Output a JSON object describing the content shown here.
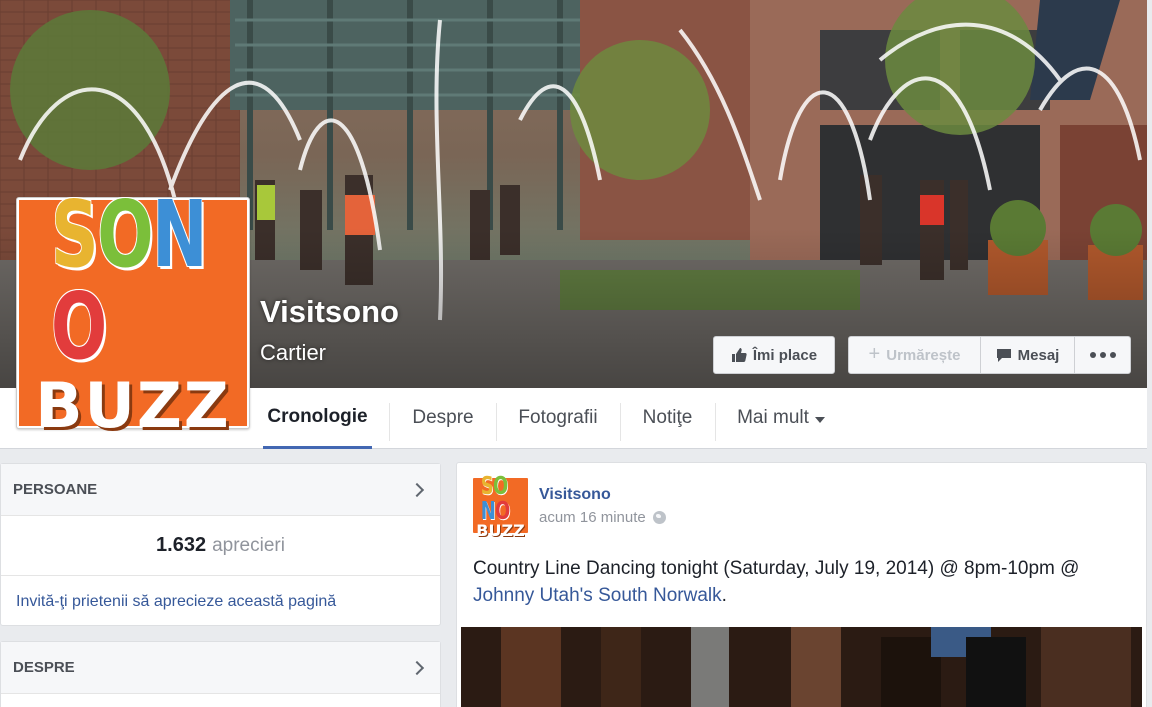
{
  "page": {
    "name": "Visitsono",
    "category": "Cartier"
  },
  "logo": {
    "letters": [
      "S",
      "O",
      "N",
      "O"
    ],
    "colors": [
      "#e8b430",
      "#7bbf3a",
      "#3d8fd6",
      "#e23c3c"
    ],
    "buzz": "BUZZ",
    "background": "#f26a25"
  },
  "actions": {
    "like_label": "Îmi place",
    "follow_label": "Urmărește",
    "message_label": "Mesaj",
    "like_icon": "thumbs-up-icon",
    "follow_icon": "plus-icon",
    "message_icon": "speech-bubble-icon",
    "more_icon": "more-dots-icon"
  },
  "tabs": [
    {
      "label": "Cronologie",
      "active": true
    },
    {
      "label": "Despre"
    },
    {
      "label": "Fotografii"
    },
    {
      "label": "Notiţe"
    },
    {
      "label": "Mai mult"
    }
  ],
  "people": {
    "title": "PERSOANE",
    "likes_count": "1.632",
    "likes_label": "aprecieri",
    "invite_text": "Invită-ţi prietenii să aprecieze această pagină"
  },
  "about": {
    "title": "DESPRE"
  },
  "post": {
    "author": "Visitsono",
    "time": "acum 16 minute",
    "text_before": "Country Line Dancing tonight (Saturday, July 19, 2014) @ 8pm-10pm @ ",
    "link_text": "Johnny Utah's South Norwalk",
    "text_after": "."
  },
  "colors": {
    "link": "#365899",
    "active_tab_underline": "#4267b2"
  }
}
